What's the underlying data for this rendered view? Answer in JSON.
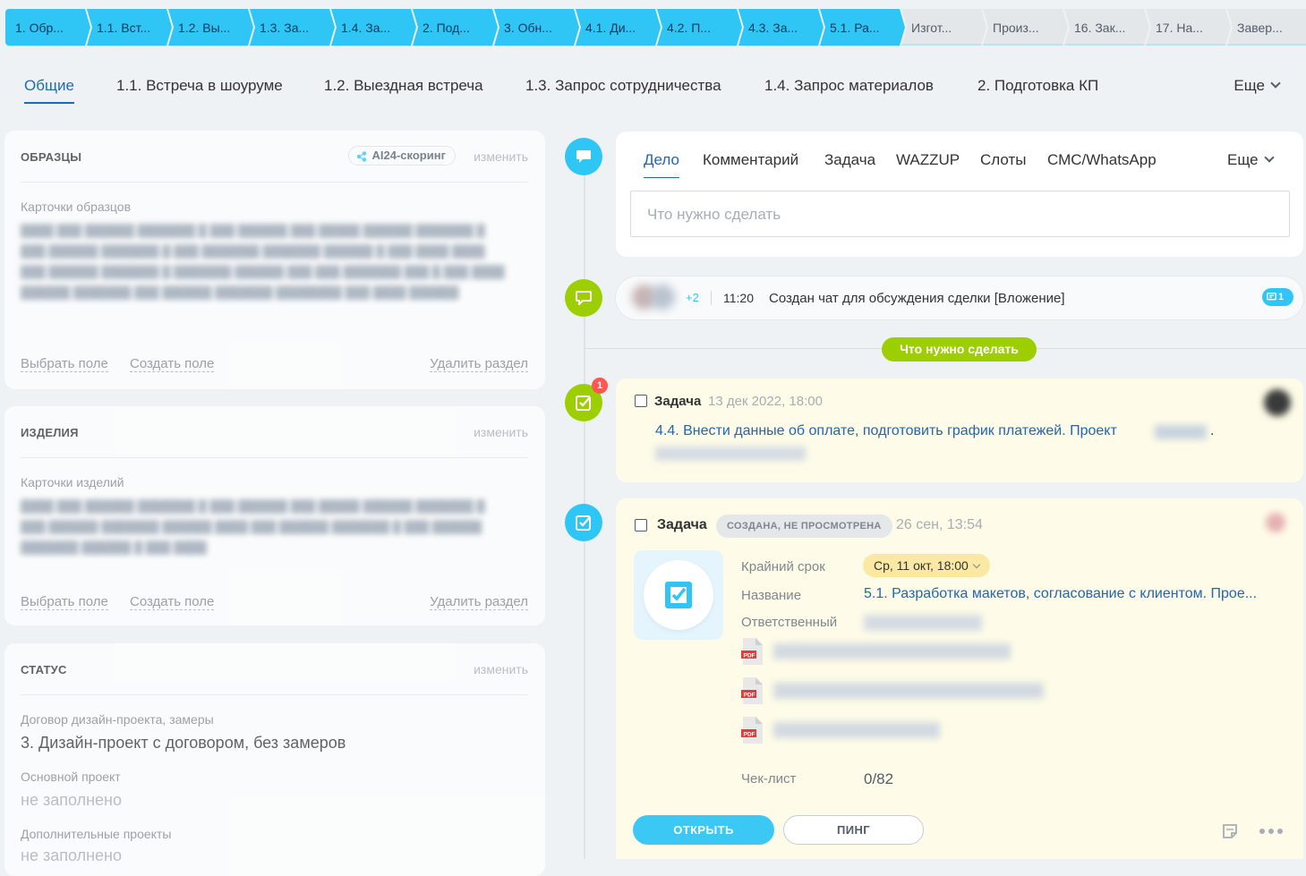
{
  "stages": [
    {
      "label": "1. Обр...",
      "done": true
    },
    {
      "label": "1.1. Вст...",
      "done": true
    },
    {
      "label": "1.2. Вы...",
      "done": true
    },
    {
      "label": "1.3. За...",
      "done": true
    },
    {
      "label": "1.4. За...",
      "done": true
    },
    {
      "label": "2. Под...",
      "done": true
    },
    {
      "label": "3. Обн...",
      "done": true
    },
    {
      "label": "4.1. Ди...",
      "done": true
    },
    {
      "label": "4.2. П...",
      "done": true
    },
    {
      "label": "4.3. За...",
      "done": true
    },
    {
      "label": "5.1. Ра...",
      "done": true
    },
    {
      "label": "Изгот...",
      "done": false
    },
    {
      "label": "Произ...",
      "done": false
    },
    {
      "label": "16. Зак...",
      "done": false
    },
    {
      "label": "17. На...",
      "done": false
    },
    {
      "label": "Завер...",
      "done": false
    }
  ],
  "tabs": {
    "items": [
      "Общие",
      "1.1. Встреча в шоуруме",
      "1.2. Выездная встреча",
      "1.3. Запрос сотрудничества",
      "1.4. Запрос материалов",
      "2. Подготовка КП"
    ],
    "more": "Еще"
  },
  "samples": {
    "title": "ОБРАЗЦЫ",
    "ai_label": "AI24-скоринг",
    "edit": "изменить",
    "field_label": "Карточки образцов",
    "select_field": "Выбрать поле",
    "create_field": "Создать поле",
    "delete_section": "Удалить раздел"
  },
  "products": {
    "title": "ИЗДЕЛИЯ",
    "edit": "изменить",
    "field_label": "Карточки изделий",
    "select_field": "Выбрать поле",
    "create_field": "Создать поле",
    "delete_section": "Удалить раздел"
  },
  "status": {
    "title": "СТАТУС",
    "edit": "изменить",
    "f1_label": "Договор дизайн-проекта, замеры",
    "f1_value": "3. Дизайн-проект с договором, без замеров",
    "f2_label": "Основной проект",
    "f2_value": "не заполнено",
    "f3_label": "Дополнительные проекты",
    "f3_value": "не заполнено"
  },
  "activity": {
    "tabs": [
      "Дело",
      "Комментарий",
      "Задача",
      "WAZZUP",
      "Слоты",
      "СМС/WhatsApp"
    ],
    "more": "Еще",
    "placeholder": "Что нужно сделать"
  },
  "chat": {
    "plus": "+2",
    "time": "11:20",
    "text": "Создан чат для обсуждения сделки [Вложение]",
    "count": "1"
  },
  "divider_label": "Что нужно сделать",
  "task1": {
    "badge": "1",
    "title": "Задача",
    "date": "13 дек 2022, 18:00",
    "link": "4.4. Внести данные об оплате, подготовить график платежей. Проект",
    "tail": "."
  },
  "task2": {
    "title": "Задача",
    "status": "СОЗДАНА, НЕ ПРОСМОТРЕНА",
    "date": "26 сен, 13:54",
    "deadline_label": "Крайний срок",
    "deadline_value": "Ср, 11 окт, 18:00",
    "name_label": "Название",
    "name_value": "5.1. Разработка макетов, согласование с клиентом. Прое...",
    "resp_label": "Ответственный",
    "checklist_label": "Чек-лист",
    "checklist_value": "0/82",
    "open_btn": "ОТКРЫТЬ",
    "ping_btn": "ПИНГ"
  },
  "colors": {
    "accent": "#2fc6f6",
    "green": "#9dcf00",
    "link": "#2066b0",
    "task_bg": "#fefce8"
  }
}
